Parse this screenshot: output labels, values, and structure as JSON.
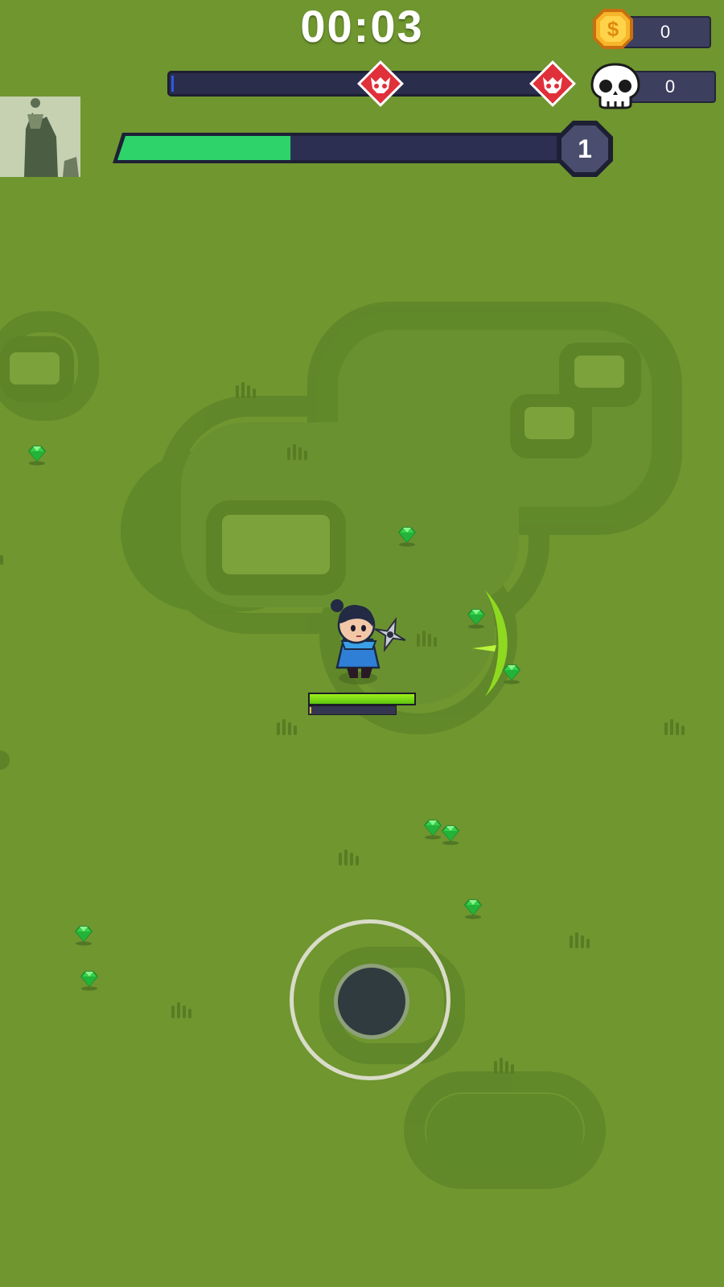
{
  "hud": {
    "timer": "00:03",
    "coins": "0",
    "kills": "0",
    "level": "1",
    "xp_progress": 0.38,
    "wave_progress": 0.01,
    "player_hp_fraction": 1.0
  },
  "icons": {
    "coin": "gold-coin-dollar-icon",
    "kills": "skull-icon",
    "boss": "red-demon-skull-icon",
    "level": "hexagon-badge-icon",
    "weapon": "shuriken-icon",
    "pickup": "green-gem-icon"
  },
  "colors": {
    "grass": "#6f962f",
    "grass_dark": "#5d8228",
    "xp_green": "#2ed36a",
    "hp_green": "#8ee81a",
    "panel": "#2a2d4c",
    "boss_red": "#e0303a",
    "coin_gold": "#f5a623"
  }
}
